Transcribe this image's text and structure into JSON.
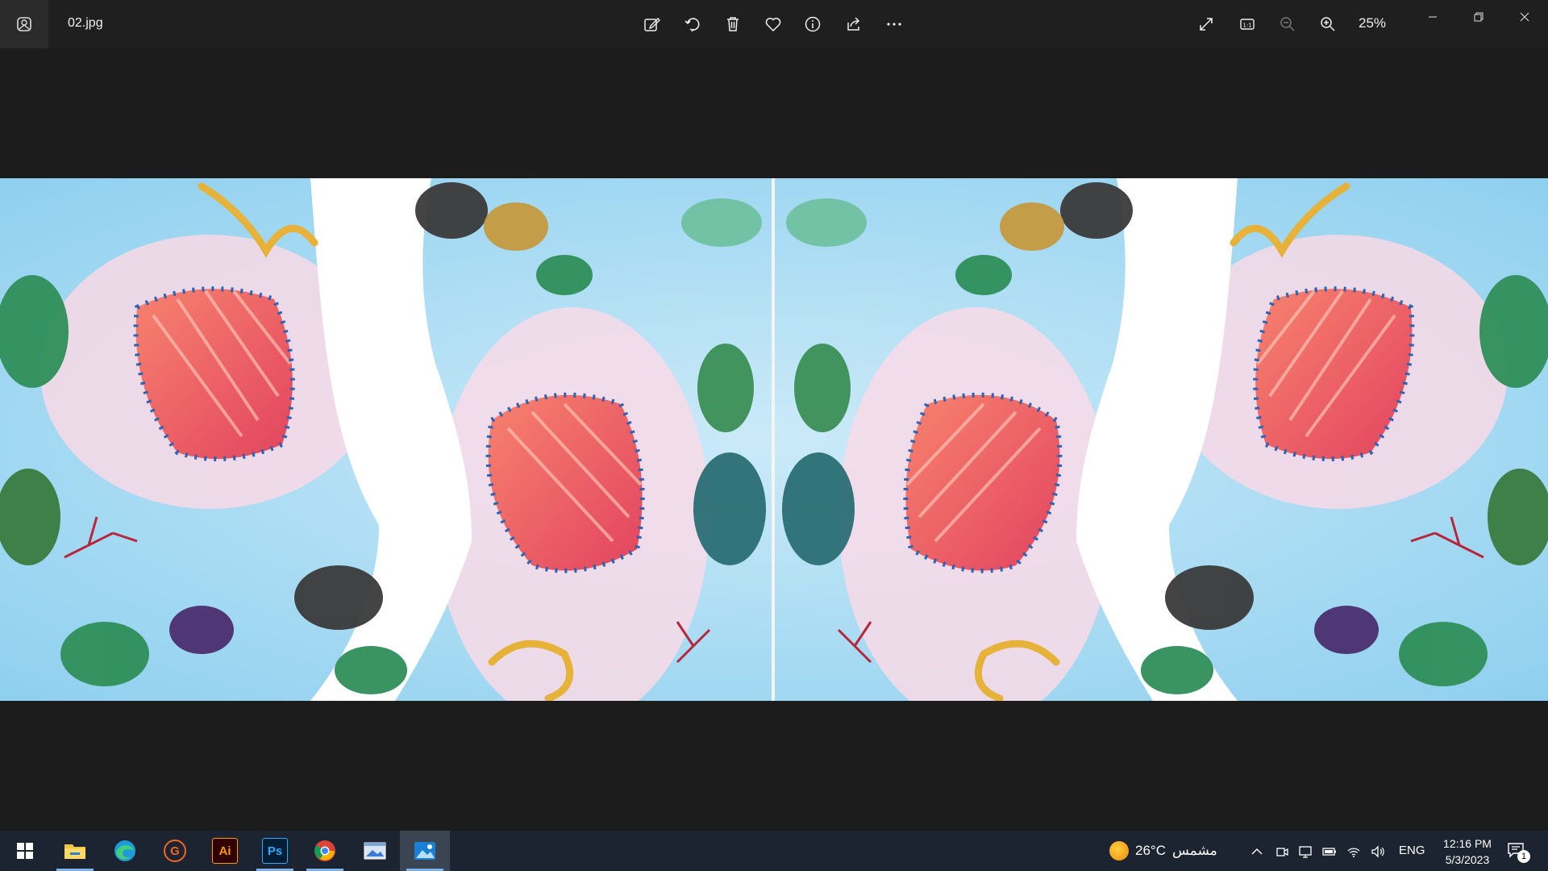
{
  "window": {
    "filename": "02.jpg",
    "zoom": "25%",
    "toolbar": [
      "edit-image",
      "rotate",
      "delete",
      "favorite",
      "file-info",
      "share",
      "see-more"
    ],
    "view_controls": [
      "full-screen",
      "actual-size",
      "zoom-out",
      "zoom-in"
    ],
    "window_controls": [
      "minimize",
      "restore",
      "close"
    ]
  },
  "photo": {
    "description_colors": {
      "sky": "#a8dcf2",
      "pink": "#f8d6e4",
      "shell": "#ef5a6e",
      "gold": "#e8b63a",
      "white": "#ffffff"
    }
  },
  "taskbar": {
    "apps": [
      "start",
      "file-explorer",
      "edge",
      "grammarly",
      "illustrator",
      "photoshop",
      "chrome",
      "image-viewer",
      "photos"
    ],
    "ai_label": "Ai",
    "ps_label": "Ps",
    "g_label": "G",
    "weather_temp": "26°C",
    "weather_text": "مشمس",
    "language": "ENG",
    "time": "12:16 PM",
    "date": "5/3/2023",
    "notifications": "1"
  }
}
